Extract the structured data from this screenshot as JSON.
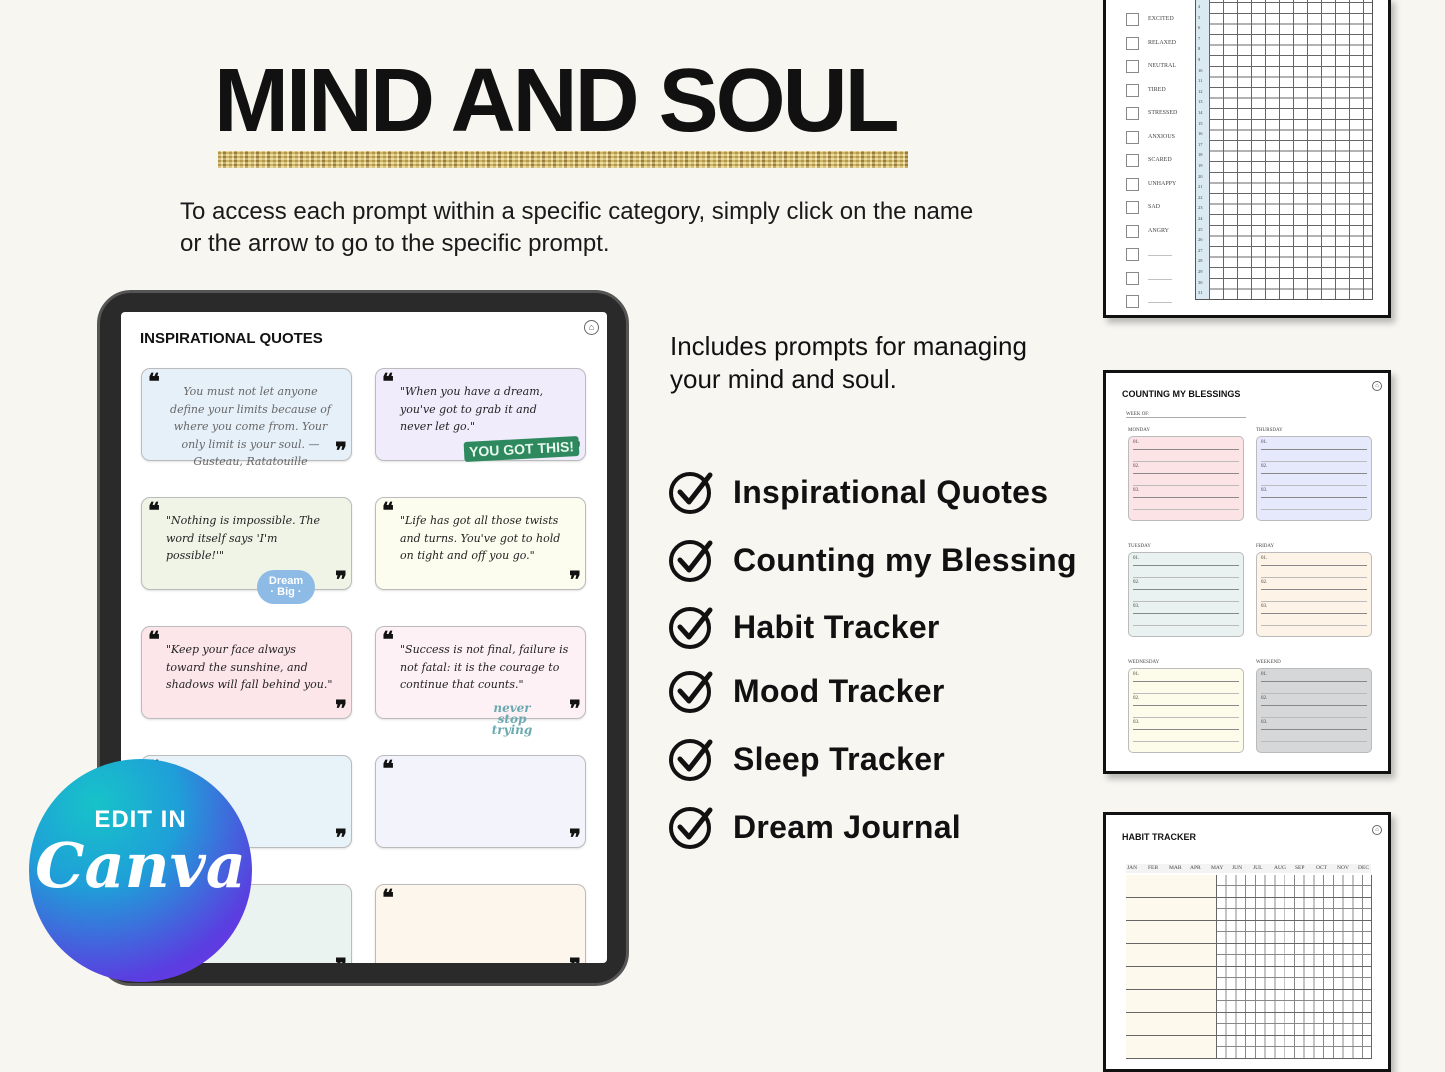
{
  "header": {
    "title": "MIND AND SOUL",
    "intro": "To access each prompt within a specific category, simply click on the name or the arrow to go to the specific prompt."
  },
  "tablet": {
    "screen_title": "INSPIRATIONAL QUOTES",
    "cards": [
      {
        "text": "You must not let anyone define your limits because of where you come from. Your only limit is your soul. — Gusteau, Ratatouille",
        "color": "#e6f0f9"
      },
      {
        "text": "\"When you have a dream, you've got to grab it and never let go.\"",
        "color": "#f1ecfb",
        "sticker": "YOU GOT THIS!"
      },
      {
        "text": "\"Nothing is impossible. The word itself says 'I'm possible!'\"",
        "color": "#eff4e7",
        "sticker": "Dream · Big ·"
      },
      {
        "text": "\"Life has got all those twists and turns. You've got to hold on tight and off you go.\"",
        "color": "#fdfdef"
      },
      {
        "text": "\"Keep your face always toward the sunshine, and shadows will fall behind you.\"",
        "color": "#fde6e9"
      },
      {
        "text": "\"Success is not final, failure is not fatal: it is the courage to continue that counts.\"",
        "color": "#fdf1f5",
        "sticker": "never stop trying"
      },
      {
        "text": "",
        "color": "#e7f2f9"
      },
      {
        "text": "",
        "color": "#f3f3fc"
      },
      {
        "text": "",
        "color": "#ebf3f1"
      },
      {
        "text": "",
        "color": "#fdf6ec"
      }
    ]
  },
  "badge": {
    "line1": "EDIT IN",
    "line2": "Canva"
  },
  "features": {
    "intro": "Includes prompts for managing your mind and soul.",
    "items": [
      "Inspirational Quotes",
      "Counting my Blessing",
      "Habit Tracker",
      "Mood Tracker",
      "Sleep Tracker",
      "Dream Journal"
    ]
  },
  "mood_page": {
    "moods": [
      "EXCITED",
      "RELAXED",
      "NEUTRAL",
      "TIRED",
      "STRESSED",
      "ANXIOUS",
      "SCARED",
      "UNHAPPY",
      "SAD",
      "ANGRY",
      "________",
      "________",
      "________"
    ],
    "days": [
      "4",
      "5",
      "6",
      "7",
      "8",
      "9",
      "10",
      "11",
      "12",
      "13",
      "14",
      "15",
      "16",
      "17",
      "18",
      "19",
      "20",
      "21",
      "22",
      "23",
      "24",
      "25",
      "26",
      "27",
      "28",
      "29",
      "30",
      "31"
    ]
  },
  "blessings_page": {
    "title": "COUNTING MY BLESSINGS",
    "week_of": "WEEK OF:",
    "days": [
      {
        "name": "MONDAY",
        "color": "#fbe3e6"
      },
      {
        "name": "THURSDAY",
        "color": "#e6e8fb"
      },
      {
        "name": "TUESDAY",
        "color": "#e9f1f1"
      },
      {
        "name": "FRIDAY",
        "color": "#fdf3e6"
      },
      {
        "name": "WEDNESDAY",
        "color": "#fdfbea"
      },
      {
        "name": "WEEKEND",
        "color": "#d6d7d9"
      }
    ],
    "numbers": [
      "01.",
      "02.",
      "03."
    ]
  },
  "habit_page": {
    "title": "HABIT TRACKER",
    "months": [
      "JAN",
      "FEB",
      "MAR",
      "APR",
      "MAY",
      "JUN",
      "JUL",
      "AUG",
      "SEP",
      "OCT",
      "NOV",
      "DEC"
    ]
  }
}
